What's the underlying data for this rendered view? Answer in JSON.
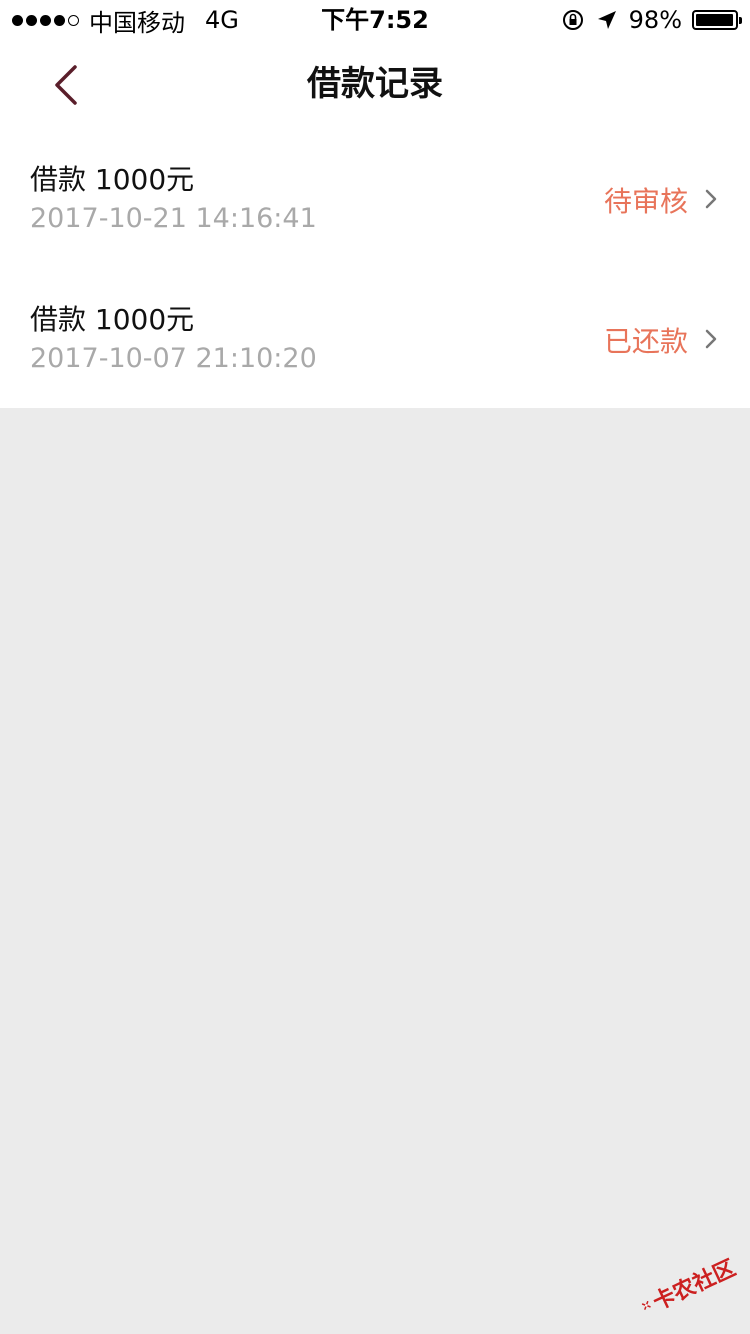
{
  "status_bar": {
    "carrier": "中国移动",
    "network": "4G",
    "time": "下午7:52",
    "battery_percent": "98%",
    "battery_level": 0.98,
    "icons": [
      "signal-dots",
      "orientation-lock-icon",
      "location-arrow-icon",
      "battery-icon"
    ]
  },
  "nav": {
    "title": "借款记录",
    "back_icon": "chevron-left-icon"
  },
  "records": [
    {
      "title": "借款 1000元",
      "time": "2017-10-21 14:16:41",
      "status": "待审核"
    },
    {
      "title": "借款 1000元",
      "time": "2017-10-07 21:10:20",
      "status": "已还款"
    }
  ],
  "watermark": {
    "text": "卡农社区"
  },
  "colors": {
    "status_accent": "#e8745a",
    "back_arrow": "#5a1e2a",
    "background": "#ebebeb",
    "timestamp": "#a9a9a9"
  }
}
